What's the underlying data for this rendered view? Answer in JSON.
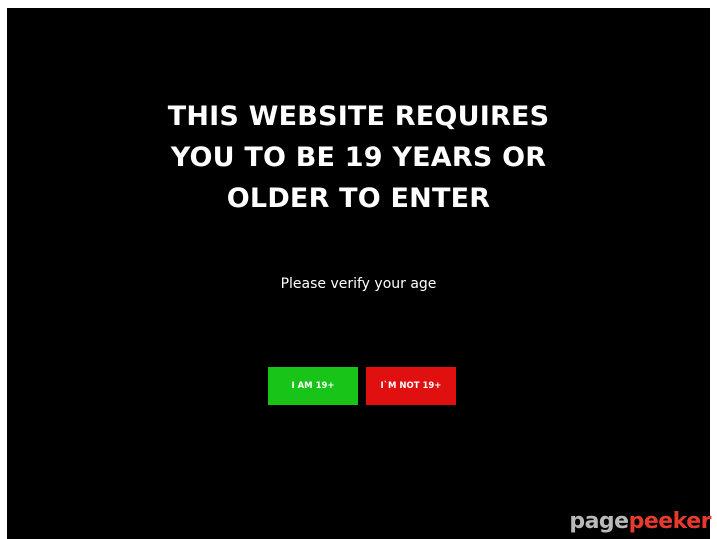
{
  "gate": {
    "headline": [
      "THIS WEBSITE REQUIRES",
      "YOU TO BE 19 YEARS OR",
      "OLDER TO ENTER"
    ],
    "subtitle": "Please verify your age",
    "confirm_label": "I AM 19+",
    "deny_label": "I`M NOT 19+"
  },
  "watermark": {
    "part1": "page",
    "part2": "peeker"
  },
  "colors": {
    "background": "#000000",
    "confirm": "#18c418",
    "deny": "#e01010",
    "text": "#ffffff"
  }
}
